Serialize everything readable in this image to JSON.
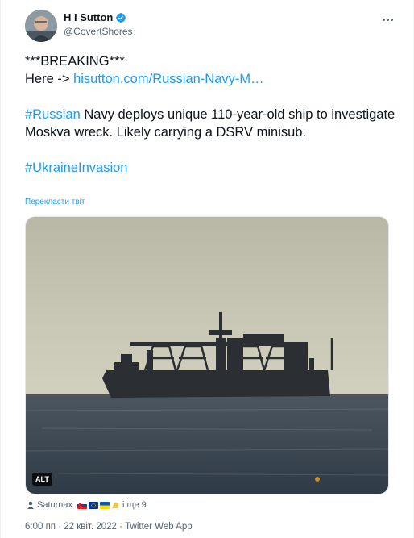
{
  "author": {
    "display_name": "H I Sutton",
    "handle": "@CovertShores"
  },
  "tweet": {
    "line1": "***BREAKING***",
    "here_prefix": "Here -> ",
    "link_text": "hisutton.com/Russian-Navy-M…",
    "hashtag_russian": "#Russian",
    "body": " Navy deploys unique 110-year-old ship to investigate Moskva wreck. Likely carrying a DSRV minisub.",
    "hashtag_invasion": "#UkraineInvasion",
    "translate_label": "Перекласти твіт"
  },
  "media": {
    "alt_label": "ALT"
  },
  "tags": {
    "user": "Saturnax",
    "others": "і ще 9"
  },
  "meta": {
    "timestamp": "6:00 пп · 22 квіт. 2022 · Twitter Web App"
  },
  "colors": {
    "accent": "#1d9bf0",
    "verified": "#1d9bf0",
    "secondary_text": "#536471"
  },
  "icons": [
    "verified-badge-icon",
    "more-options-icon",
    "person-tag-icon"
  ]
}
